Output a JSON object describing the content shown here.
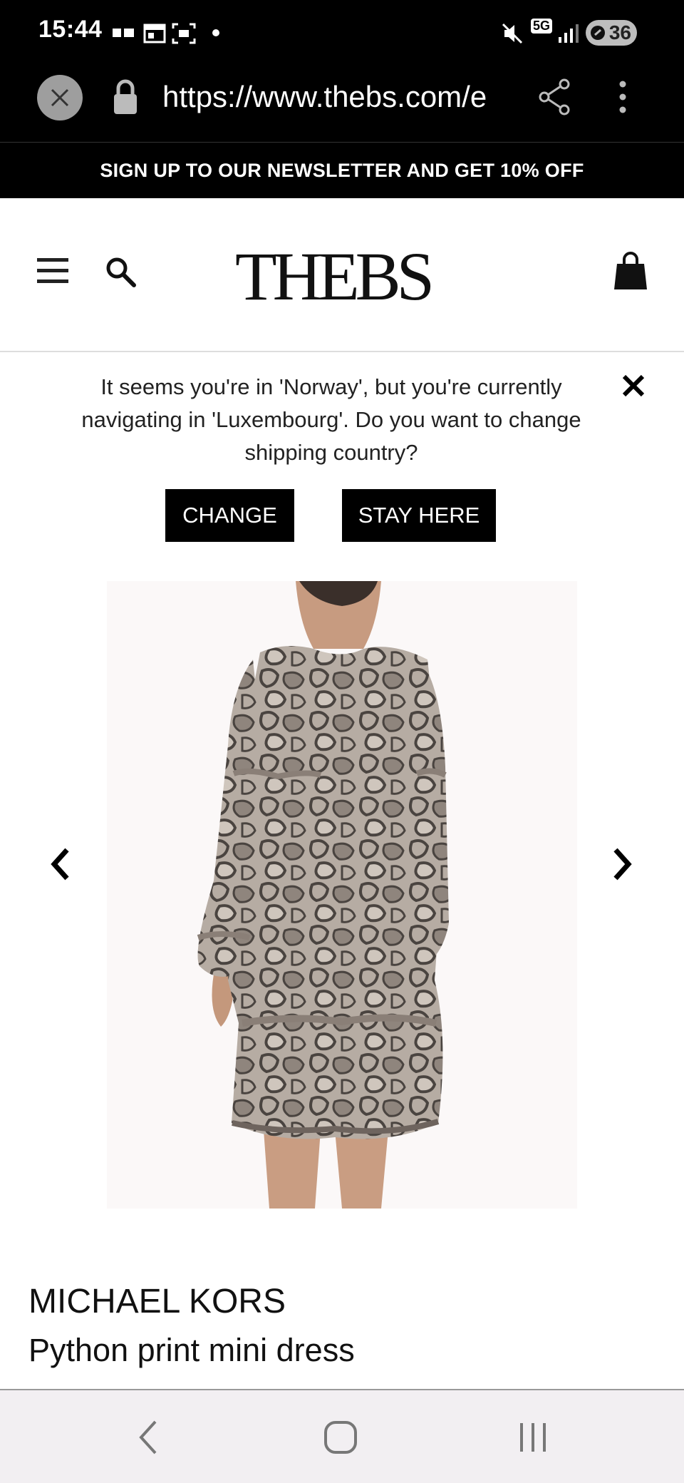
{
  "status_bar": {
    "time": "15:44",
    "battery": "36",
    "network": "5G"
  },
  "browser": {
    "url": "https://www.thebs.com/e"
  },
  "newsletter": {
    "text": "SIGN UP TO OUR NEWSLETTER AND GET 10% OFF"
  },
  "header": {
    "logo_text": "THEBS"
  },
  "country_banner": {
    "message": "It seems you're in 'Norway', but you're currently navigating in 'Luxembourg'. Do you want to change shipping country?",
    "change_label": "CHANGE",
    "stay_label": "STAY HERE"
  },
  "product": {
    "brand": "MICHAEL KORS",
    "name": "Python print mini dress"
  },
  "colors": {
    "black": "#000000",
    "white": "#ffffff",
    "dress_base": "#b6aca3",
    "dress_pattern": "#4a4440"
  }
}
